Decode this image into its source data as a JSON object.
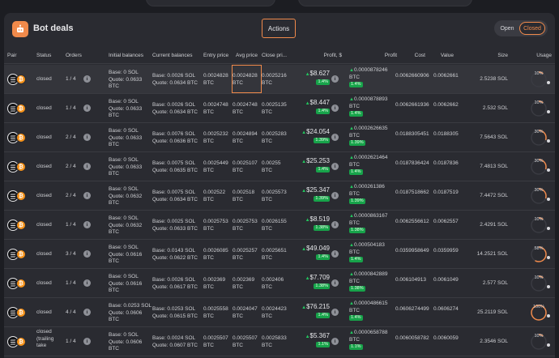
{
  "header": {
    "title": "Bot deals",
    "actions_label": "Actions",
    "toggle_open": "Open",
    "toggle_closed": "Closed"
  },
  "columns": {
    "pair": "Pair",
    "status": "Status",
    "orders": "Orders",
    "initial_balances": "Initial balances",
    "current_balances": "Current balances",
    "entry_price": "Entry price",
    "avg_price": "Avg price",
    "close_price": "Close pri...",
    "profit_usd": "Profit, $",
    "profit": "Profit",
    "cost": "Cost",
    "value": "Value",
    "size": "Size",
    "usage": "Usage"
  },
  "info_glyph": "i",
  "btc_glyph": "₿",
  "accent_color": "#f08a4b",
  "positive_color": "#22c55e",
  "rows": [
    {
      "status": "closed",
      "orders": "1 / 4",
      "init_base": "Base: 0 SOL",
      "init_quote": "Quote: 0.0633",
      "init_unit": "BTC",
      "cur_base": "Base: 0.0026 SOL",
      "cur_quote": "Quote: 0.0634 BTC",
      "entry": "0.0024828",
      "avg": "0.0024828",
      "close": "0.0025216",
      "unit": "BTC",
      "profit_usd": "$8.627",
      "pct": "1.4%",
      "profit": "0.0000878246",
      "profit_unit": "BTC",
      "profit_pct": "1.4%",
      "cost": "0.0062660906",
      "value": "0.0062661",
      "size": "2.5238 SOL",
      "usage": "10%",
      "usage_pct": 10
    },
    {
      "status": "closed",
      "orders": "1 / 4",
      "init_base": "Base: 0 SOL",
      "init_quote": "Quote: 0.0633",
      "init_unit": "BTC",
      "cur_base": "Base: 0.0026 SOL",
      "cur_quote": "Quote: 0.0634 BTC",
      "entry": "0.0024748",
      "avg": "0.0024748",
      "close": "0.0025135",
      "unit": "BTC",
      "profit_usd": "$8.447",
      "pct": "1.4%",
      "profit": "0.0000878893",
      "profit_unit": "BTC",
      "profit_pct": "1.4%",
      "cost": "0.0062661936",
      "value": "0.0062662",
      "size": "2.532 SOL",
      "usage": "10%",
      "usage_pct": 10
    },
    {
      "status": "closed",
      "orders": "2 / 4",
      "init_base": "Base: 0 SOL",
      "init_quote": "Quote: 0.0633",
      "init_unit": "BTC",
      "cur_base": "Base: 0.0076 SOL",
      "cur_quote": "Quote: 0.0636 BTC",
      "entry": "0.0025232",
      "avg": "0.0024894",
      "close": "0.0025283",
      "unit": "BTC",
      "profit_usd": "$24.054",
      "pct": "1.39%",
      "profit": "0.0002626635",
      "profit_unit": "BTC",
      "profit_pct": "1.39%",
      "cost": "0.0188305451",
      "value": "0.0188305",
      "size": "7.5643 SOL",
      "usage": "30%",
      "usage_pct": 30
    },
    {
      "status": "closed",
      "orders": "2 / 4",
      "init_base": "Base: 0 SOL",
      "init_quote": "Quote: 0.0633",
      "init_unit": "BTC",
      "cur_base": "Base: 0.0075 SOL",
      "cur_quote": "Quote: 0.0635 BTC",
      "entry": "0.0025449",
      "avg": "0.0025107",
      "close": "0.00255",
      "unit": "BTC",
      "profit_usd": "$25.253",
      "pct": "1.4%",
      "profit": "0.0002621464",
      "profit_unit": "BTC",
      "profit_pct": "1.4%",
      "cost": "0.0187836424",
      "value": "0.0187836",
      "size": "7.4813 SOL",
      "usage": "30%",
      "usage_pct": 30
    },
    {
      "status": "closed",
      "orders": "2 / 4",
      "init_base": "Base: 0 SOL",
      "init_quote": "Quote: 0.0632",
      "init_unit": "BTC",
      "cur_base": "Base: 0.0075 SOL",
      "cur_quote": "Quote: 0.0634 BTC",
      "entry": "0.002522",
      "avg": "0.002518",
      "close": "0.0025573",
      "unit": "BTC",
      "profit_usd": "$25.347",
      "pct": "1.39%",
      "profit": "0.000261386",
      "profit_unit": "BTC",
      "profit_pct": "1.39%",
      "cost": "0.0187518662",
      "value": "0.0187519",
      "size": "7.4472 SOL",
      "usage": "30%",
      "usage_pct": 30
    },
    {
      "status": "closed",
      "orders": "1 / 4",
      "init_base": "Base: 0 SOL",
      "init_quote": "Quote: 0.0632",
      "init_unit": "BTC",
      "cur_base": "Base: 0.0025 SOL",
      "cur_quote": "Quote: 0.0633 BTC",
      "entry": "0.0025753",
      "avg": "0.0025753",
      "close": "0.0026155",
      "unit": "BTC",
      "profit_usd": "$8.519",
      "pct": "1.38%",
      "profit": "0.0000863167",
      "profit_unit": "BTC",
      "profit_pct": "1.38%",
      "cost": "0.0062556612",
      "value": "0.0062557",
      "size": "2.4291 SOL",
      "usage": "10%",
      "usage_pct": 10
    },
    {
      "status": "closed",
      "orders": "3 / 4",
      "init_base": "Base: 0 SOL",
      "init_quote": "Quote: 0.0616",
      "init_unit": "BTC",
      "cur_base": "Base: 0.0143 SOL",
      "cur_quote": "Quote: 0.0622 BTC",
      "entry": "0.0026085",
      "avg": "0.0025257",
      "close": "0.0025651",
      "unit": "BTC",
      "profit_usd": "$49.049",
      "pct": "1.4%",
      "profit": "0.000504183",
      "profit_unit": "BTC",
      "profit_pct": "1.4%",
      "cost": "0.0359958649",
      "value": "0.0359959",
      "size": "14.2521 SOL",
      "usage": "58%",
      "usage_pct": 58
    },
    {
      "status": "closed",
      "orders": "1 / 4",
      "init_base": "Base: 0 SOL",
      "init_quote": "Quote: 0.0616",
      "init_unit": "BTC",
      "cur_base": "Base: 0.0026 SOL",
      "cur_quote": "Quote: 0.0617 BTC",
      "entry": "0.002369",
      "avg": "0.002369",
      "close": "0.002406",
      "unit": "BTC",
      "profit_usd": "$7.709",
      "pct": "1.38%",
      "profit": "0.0000842889",
      "profit_unit": "BTC",
      "profit_pct": "1.38%",
      "cost": "0.006104913",
      "value": "0.0061049",
      "size": "2.577 SOL",
      "usage": "10%",
      "usage_pct": 10
    },
    {
      "status": "closed",
      "orders": "4 / 4",
      "init_base": "Base: 0.0253 SOL",
      "init_quote": "Quote: 0.0606",
      "init_unit": "BTC",
      "cur_base": "Base: 0.0253 SOL",
      "cur_quote": "Quote: 0.0615 BTC",
      "entry": "0.0025558",
      "avg": "0.0024047",
      "close": "0.0024423",
      "unit": "BTC",
      "profit_usd": "$76.215",
      "pct": "1.4%",
      "profit": "0.0000486615",
      "profit_unit": "BTC",
      "profit_pct": "1.4%",
      "cost": "0.0606274499",
      "value": "0.0606274",
      "size": "25.2119 SOL",
      "usage": "100%",
      "usage_pct": 100
    },
    {
      "status": "closed",
      "status2": "(trailing",
      "status3": "take",
      "orders": "1 / 4",
      "init_base": "Base: 0 SOL",
      "init_quote": "Quote: 0.0606",
      "init_unit": "BTC",
      "cur_base": "Base: 0.0024 SOL",
      "cur_quote": "Quote: 0.0607 BTC",
      "entry": "0.0025507",
      "avg": "0.0025507",
      "close": "0.0025833",
      "unit": "BTC",
      "profit_usd": "$5.367",
      "pct": "1.1%",
      "profit": "0.0000658788",
      "profit_unit": "BTC",
      "profit_pct": "1.1%",
      "cost": "0.0060058782",
      "value": "0.0060059",
      "size": "2.3546 SOL",
      "usage": "10%",
      "usage_pct": 10
    }
  ]
}
